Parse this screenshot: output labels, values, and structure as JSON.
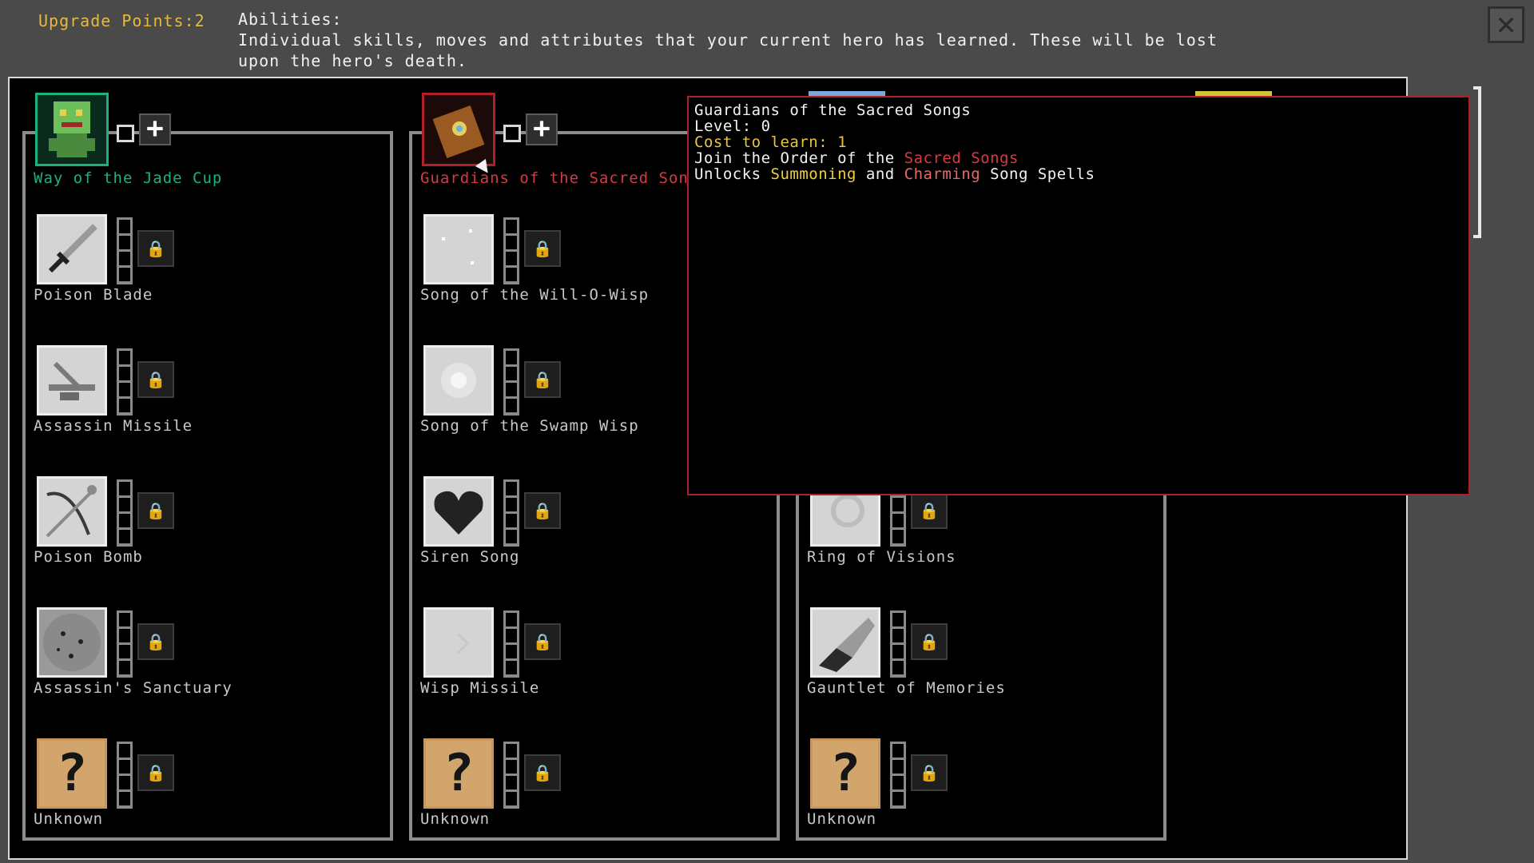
{
  "header": {
    "upgrade_points": "Upgrade Points:2",
    "abilities_title": "Abilities:",
    "abilities_desc": "Individual skills, moves and attributes that your current hero has learned.  These will be lost upon the hero's death."
  },
  "close_icon": "close-x-icon",
  "columns": [
    {
      "name": "Way of the Jade Cup",
      "name_color": "#1bb37a",
      "skills": [
        {
          "name": "Poison Blade",
          "icon": "dagger-icon"
        },
        {
          "name": "Assassin Missile",
          "icon": "crossbow-icon"
        },
        {
          "name": "Poison Bomb",
          "icon": "bow-icon"
        },
        {
          "name": "Assassin's Sanctuary",
          "icon": "stone-circle-icon"
        },
        {
          "name": "Unknown",
          "icon": "question-mark-icon"
        }
      ]
    },
    {
      "name": "Guardians of the Sacred Song",
      "name_color": "#d53a42",
      "skills": [
        {
          "name": "Song of the Will-O-Wisp",
          "icon": "sparkle-icon"
        },
        {
          "name": "Song of the Swamp Wisp",
          "icon": "wisp-orb-icon"
        },
        {
          "name": "Siren Song",
          "icon": "heart-icon"
        },
        {
          "name": "Wisp Missile",
          "icon": "wisp-arrow-icon"
        },
        {
          "name": "Unknown",
          "icon": "question-mark-icon"
        }
      ]
    },
    {
      "name": "",
      "skills": [
        {
          "name": "",
          "icon": "hidden"
        },
        {
          "name": "",
          "icon": "hidden"
        },
        {
          "name": "Ring of Visions",
          "icon": "ring-icon"
        },
        {
          "name": "Gauntlet of Memories",
          "icon": "gauntlet-icon"
        },
        {
          "name": "Unknown",
          "icon": "question-mark-icon"
        }
      ]
    }
  ],
  "tooltip": {
    "title": "Guardians of the Sacred Songs",
    "level": "Level: 0",
    "cost": "Cost to learn: 1",
    "join_prefix": "Join the Order of the ",
    "join_highlight": "Sacred Songs",
    "unlock_prefix": "Unlocks ",
    "unlock_a": "Summoning",
    "unlock_and": " and ",
    "unlock_b": "Charming",
    "unlock_suffix": " Song Spells"
  },
  "colors": {
    "background": "#4a4a4a",
    "points": "#e7b93c",
    "jade": "#1bb37a",
    "sacred": "#d53a42",
    "unknown_tile": "#d2a56c"
  },
  "unknown_glyph": "?",
  "plus_glyph": "+",
  "lock_glyph": "🔒"
}
